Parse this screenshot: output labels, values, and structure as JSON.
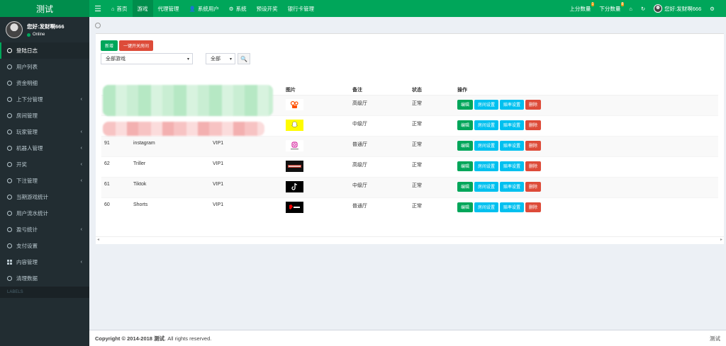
{
  "brand": "测试",
  "topnav": {
    "items": [
      {
        "label": "首页",
        "icon": "home-icon"
      },
      {
        "label": "游戏",
        "active": true
      },
      {
        "label": "代理管理"
      },
      {
        "label": "系统用户",
        "icon": "user-icon"
      },
      {
        "label": "系统",
        "icon": "gear-icon"
      },
      {
        "label": "预设开奖"
      },
      {
        "label": "银行卡管理"
      }
    ],
    "right": {
      "up_label": "上分数量",
      "up_badge": "1",
      "down_label": "下分数量",
      "down_badge": "8",
      "greeting": "您好:发财啊666"
    }
  },
  "sidebar": {
    "user_name": "您好:发财啊666",
    "status": "Online",
    "items": [
      {
        "label": "登陆日志",
        "active": true,
        "arrow": false
      },
      {
        "label": "用户列表",
        "arrow": false
      },
      {
        "label": "资金明细",
        "arrow": false
      },
      {
        "label": "上下分管理",
        "arrow": true
      },
      {
        "label": "房间管理",
        "arrow": false
      },
      {
        "label": "玩家管理",
        "arrow": true
      },
      {
        "label": "机器人管理",
        "arrow": true
      },
      {
        "label": "开奖",
        "arrow": true
      },
      {
        "label": "下注管理",
        "arrow": true
      },
      {
        "label": "当期游戏统计",
        "arrow": false
      },
      {
        "label": "用户流水统计",
        "arrow": false
      },
      {
        "label": "盈亏统计",
        "arrow": true
      },
      {
        "label": "支付设置",
        "arrow": false
      },
      {
        "label": "内容管理",
        "arrow": true,
        "icon": "grid-icon"
      },
      {
        "label": "清理数据",
        "arrow": false
      }
    ],
    "labels_header": "LABELS"
  },
  "toolbar": {
    "add_label": "新增",
    "toggle_label": "一键开关房间",
    "game_select": "全部游戏",
    "status_select": "全部"
  },
  "table": {
    "headers": [
      "",
      "",
      "",
      "图片",
      "备注",
      "状态",
      "操作"
    ],
    "rows": [
      {
        "id": "",
        "name": "",
        "level": "",
        "img": "kuaishou",
        "note": "高级厅",
        "status": "正常"
      },
      {
        "id": "",
        "name": "",
        "level": "",
        "img": "snapchat",
        "note": "中级厅",
        "status": "正常"
      },
      {
        "id": "91",
        "name": "instagram",
        "level": "VIP1",
        "img": "instagram",
        "note": "普通厅",
        "status": "正常"
      },
      {
        "id": "62",
        "name": "Triller",
        "level": "VIP1",
        "img": "triller",
        "note": "高级厅",
        "status": "正常"
      },
      {
        "id": "61",
        "name": "Tiktok",
        "level": "VIP1",
        "img": "tiktok",
        "note": "中级厅",
        "status": "正常"
      },
      {
        "id": "60",
        "name": "Shorts",
        "level": "VIP1",
        "img": "shorts",
        "note": "普通厅",
        "status": "正常"
      }
    ],
    "actions": [
      "编辑",
      "房间设置",
      "赔率设置",
      "删除"
    ]
  },
  "footer": {
    "copyright_prefix": "Copyright © 2014-2018 ",
    "brand": "测试",
    "suffix": ". All rights reserved.",
    "right": "测试"
  },
  "colors": {
    "green": "#00a65a",
    "red": "#dd4b39",
    "cyan": "#00c0ef",
    "sidebar": "#222d32"
  }
}
